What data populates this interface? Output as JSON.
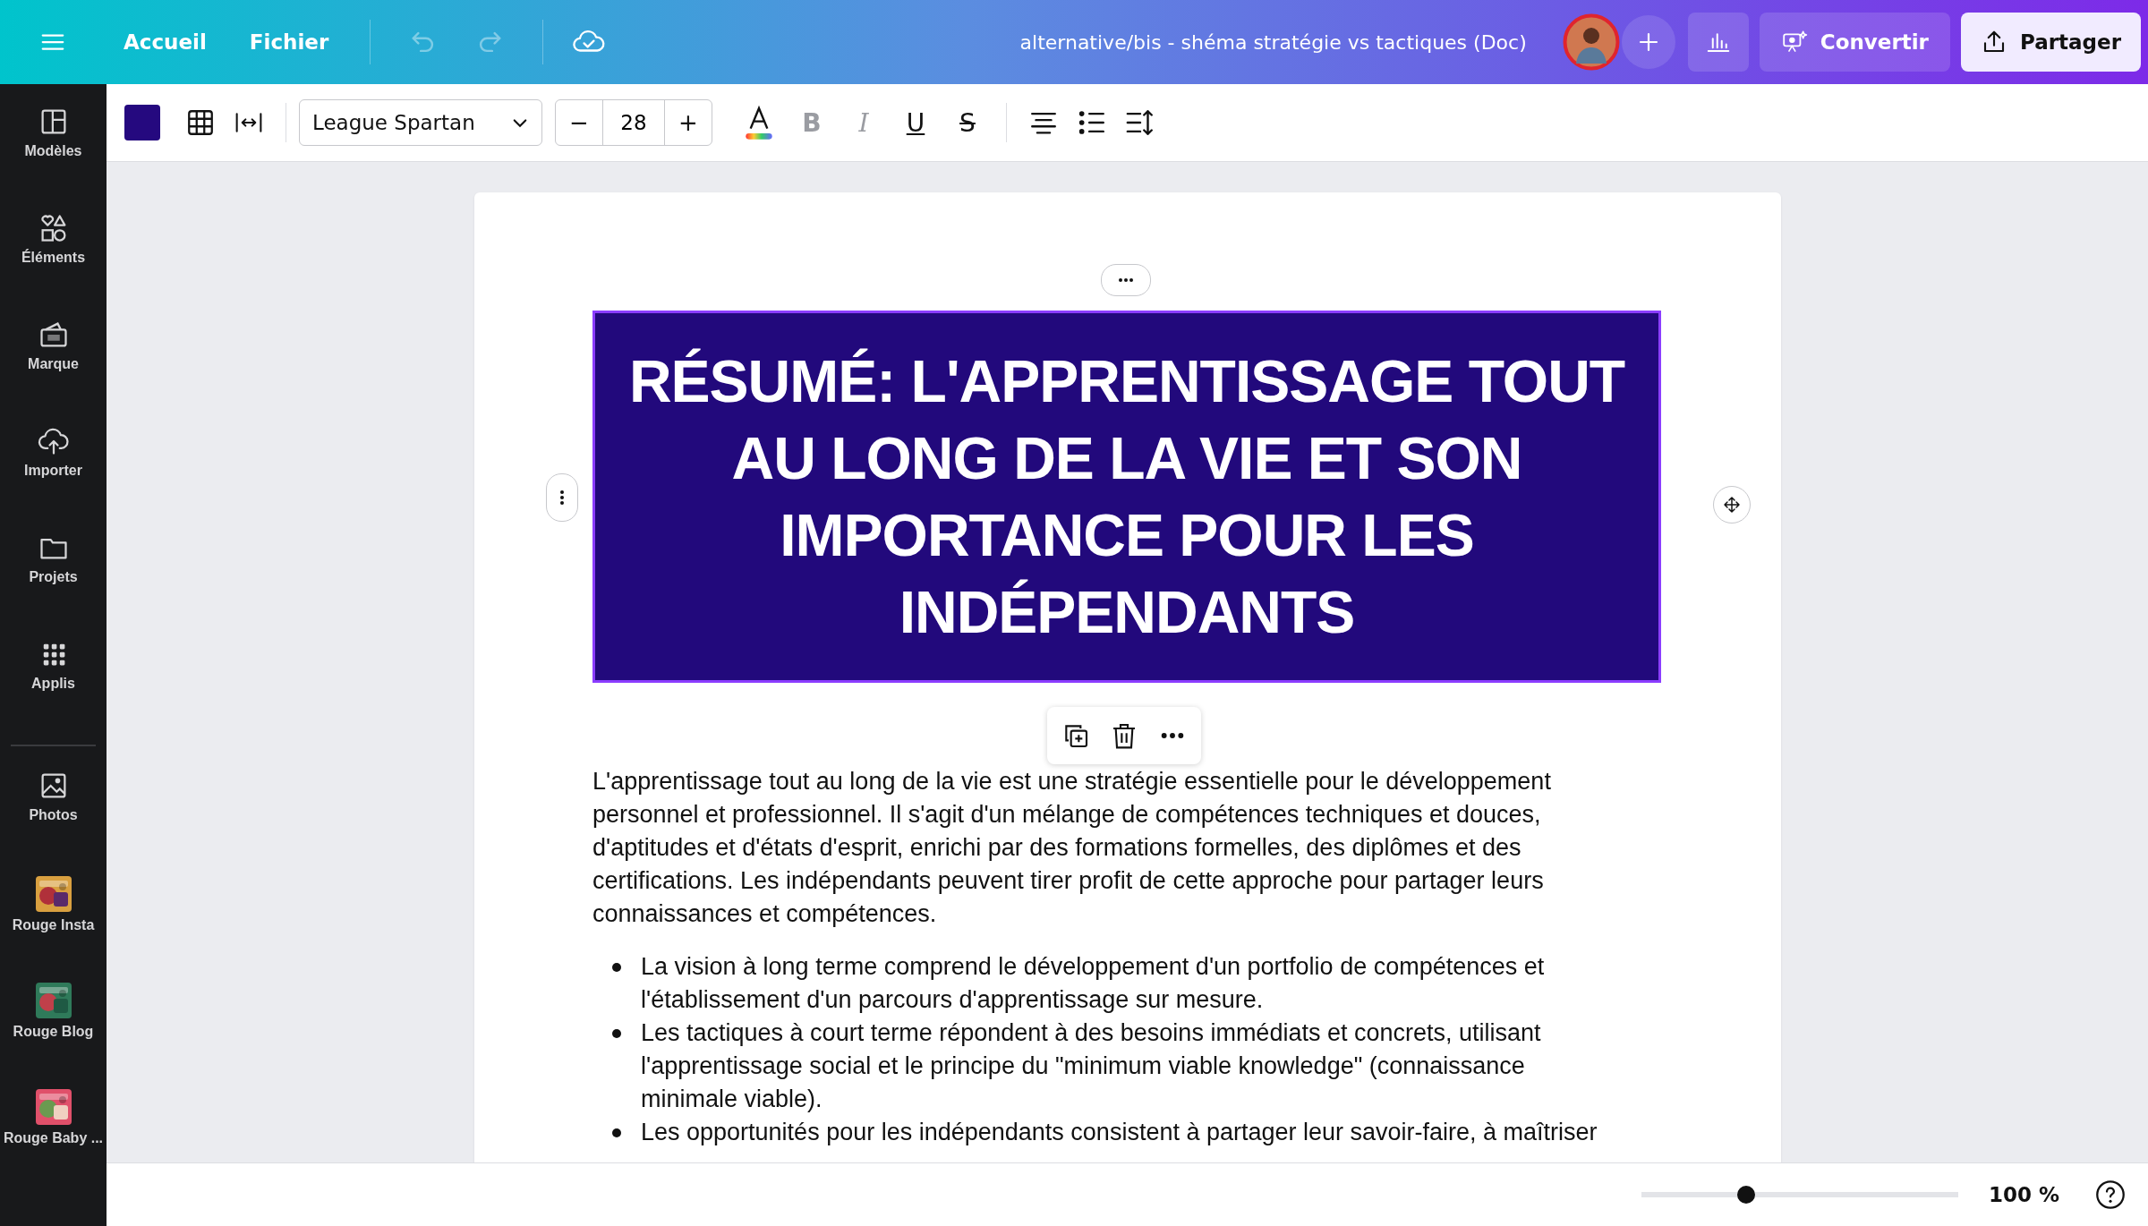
{
  "top_bar": {
    "nav": [
      "Accueil",
      "Fichier"
    ],
    "history": [
      {
        "kind": "undo",
        "disabled": true
      },
      {
        "kind": "redo",
        "disabled": true
      }
    ],
    "document_title": "alternative/bis - shéma stratégie vs tactiques (Doc)",
    "convert_button": "Convertir",
    "share_button": "Partager"
  },
  "toolbar": {
    "font": "League Spartan",
    "font_size": "28",
    "minus": "−",
    "plus": "+",
    "formats": [
      {
        "glyph": "B",
        "kind": "bold",
        "disabled": true
      },
      {
        "glyph": "I",
        "kind": "italic",
        "disabled": true
      },
      {
        "glyph": "U",
        "kind": "underline",
        "disabled": false
      },
      {
        "glyph": "S",
        "kind": "strike",
        "disabled": false
      }
    ]
  },
  "sidebar": {
    "items": [
      {
        "label": "Modèles",
        "kind": "templates"
      },
      {
        "label": "Éléments",
        "kind": "elements"
      },
      {
        "label": "Marque",
        "kind": "brand"
      },
      {
        "label": "Importer",
        "kind": "upload"
      },
      {
        "label": "Projets",
        "kind": "folder"
      },
      {
        "label": "Applis",
        "kind": "apps"
      },
      {
        "label": "Photos",
        "kind": "photos"
      },
      {
        "label": "Rouge Insta",
        "kind": "picture"
      },
      {
        "label": "Rouge Blog",
        "kind": "picture"
      },
      {
        "label": "Rouge Baby ...",
        "kind": "picture"
      }
    ]
  },
  "document": {
    "heading": "RÉSUMÉ: L'APPRENTISSAGE TOUT AU LONG DE LA VIE ET SON IMPORTANCE POUR LES INDÉPENDANTS",
    "paragraph": "L'apprentissage tout au long de la vie est une stratégie essentielle pour le développement personnel et professionnel. Il s'agit d'un mélange de compétences techniques et douces, d'aptitudes et d'états d'esprit, enrichi par des formations formelles, des diplômes et des certifications. Les indépendants peuvent tirer profit de cette approche pour partager leurs connaissances et compétences.",
    "bullets": [
      "La vision à long terme comprend le développement d'un portfolio de compétences et l'établissement d'un parcours d'apprentissage sur mesure.",
      "Les tactiques à court terme répondent à des besoins immédiats et concrets, utilisant l'apprentissage social et le principe du \"minimum viable knowledge\" (connaissance minimale viable).",
      "Les opportunités pour les indépendants consistent à partager leur savoir-faire, à maîtriser"
    ]
  },
  "zoom": {
    "level": 0.3,
    "reading": "100 %"
  }
}
